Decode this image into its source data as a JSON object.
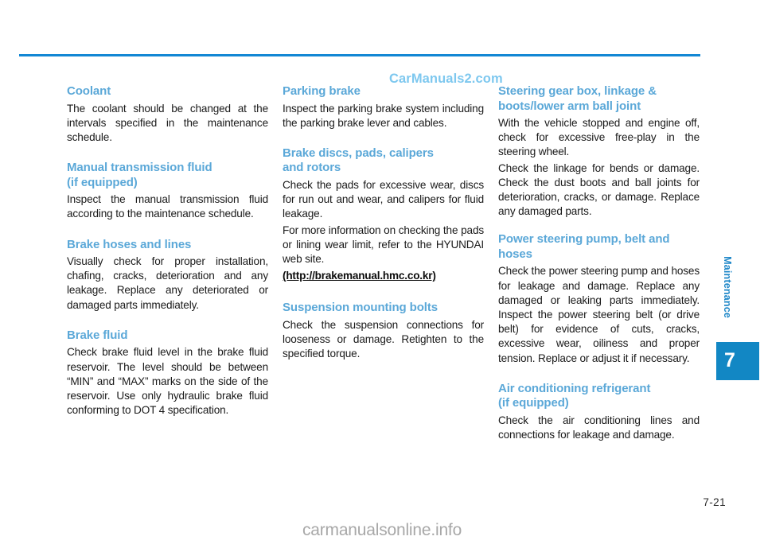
{
  "page": {
    "watermark_top": "CarManuals2.com",
    "watermark_bottom": "carmanualsonline.info",
    "page_number": "7-21",
    "rule_color": "#1287d4",
    "heading_color": "#5ba8d8"
  },
  "side_tab": {
    "label": "Maintenance",
    "chapter_number": "7",
    "box_color": "#1287c4",
    "label_color": "#1e87c8"
  },
  "columns": [
    {
      "sections": [
        {
          "heading": "Coolant",
          "paragraphs": [
            "The coolant should be changed at the intervals specified in the maintenance schedule."
          ]
        },
        {
          "heading": "Manual transmission fluid (if equipped)",
          "heading_lines": [
            "Manual transmission fluid",
            "(if equipped)"
          ],
          "paragraphs": [
            "Inspect the manual transmission fluid according to the maintenance schedule."
          ]
        },
        {
          "heading": "Brake hoses and lines",
          "paragraphs": [
            "Visually check for proper installation, chafing, cracks, deterioration and any leakage. Replace any deteriorated or damaged parts immediately."
          ]
        },
        {
          "heading": "Brake fluid",
          "paragraphs": [
            "Check brake fluid level in the brake fluid reservoir. The level should be between “MIN” and “MAX” marks on the side of the reservoir. Use only hydraulic brake fluid conforming to DOT 4 specification."
          ]
        }
      ]
    },
    {
      "sections": [
        {
          "heading": "Parking brake",
          "paragraphs": [
            "Inspect the parking brake system including the parking brake lever and cables."
          ]
        },
        {
          "heading": "Brake discs, pads, calipers and rotors",
          "heading_lines": [
            "Brake discs, pads, calipers",
            "and rotors"
          ],
          "paragraphs": [
            "Check the pads for excessive wear, discs for run out and wear, and calipers for fluid leakage.",
            "For more information on checking the pads or lining wear limit, refer to the HYUNDAI web site."
          ],
          "link": "(http://brakemanual.hmc.co.kr)"
        },
        {
          "heading": "Suspension mounting bolts",
          "paragraphs": [
            "Check the suspension connections for looseness or damage. Retighten to the specified torque."
          ]
        }
      ]
    },
    {
      "sections": [
        {
          "heading": "Steering gear box, linkage & boots/lower arm ball joint",
          "heading_lines": [
            "Steering gear box, linkage &",
            "boots/lower arm ball joint"
          ],
          "paragraphs": [
            "With the vehicle stopped and engine off, check for excessive free-play in the steering wheel.",
            "Check the linkage for bends or damage. Check the dust boots and ball joints for deterioration, cracks, or damage. Replace any damaged parts."
          ]
        },
        {
          "heading": "Power steering pump, belt and hoses",
          "heading_lines": [
            "Power steering pump, belt and",
            "hoses"
          ],
          "paragraphs": [
            "Check the power steering pump and hoses for leakage and damage. Replace any damaged or leaking parts immediately. Inspect the power steering belt (or drive belt) for evidence of cuts, cracks, excessive wear, oiliness and proper tension. Replace or adjust it if necessary."
          ]
        },
        {
          "heading": "Air conditioning refrigerant (if equipped)",
          "heading_lines": [
            "Air conditioning refrigerant",
            "(if equipped)"
          ],
          "paragraphs": [
            "Check the air conditioning lines and connections for leakage and damage."
          ]
        }
      ]
    }
  ]
}
